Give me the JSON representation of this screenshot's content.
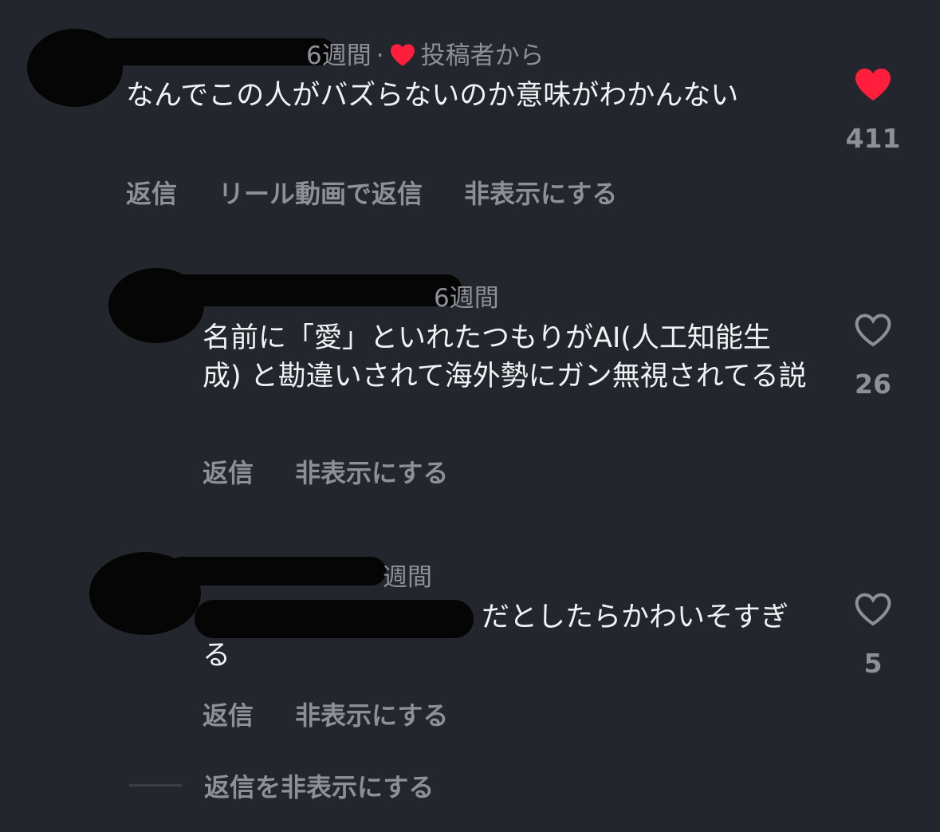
{
  "comments": [
    {
      "time": "6週間",
      "separator": "·",
      "liked_by_author_label": "投稿者から",
      "text": "なんでこの人がバズらないのか意味がわかんない",
      "likes": "411",
      "liked": true,
      "actions": [
        "返信",
        "リール動画で返信",
        "非表示にする"
      ]
    },
    {
      "time": "6週間",
      "text": "名前に「愛」といれたつもりがAI(人工知能生成) と勘違いされて海外勢にガン無視されてる説",
      "likes": "26",
      "liked": false,
      "actions": [
        "返信",
        "非表示にする"
      ]
    },
    {
      "time": "週間",
      "text": "だとしたらかわいそすぎる",
      "likes": "5",
      "liked": false,
      "actions": [
        "返信",
        "非表示にする"
      ]
    }
  ],
  "hide_replies_label": "返信を非表示にする",
  "colors": {
    "background": "#23262c",
    "text": "#f1f2f4",
    "muted": "#8d9097",
    "like_red": "#ff1f3d",
    "redaction": "#050506"
  },
  "icons": {
    "liked": "heart-filled-icon",
    "unliked": "heart-outline-icon"
  }
}
